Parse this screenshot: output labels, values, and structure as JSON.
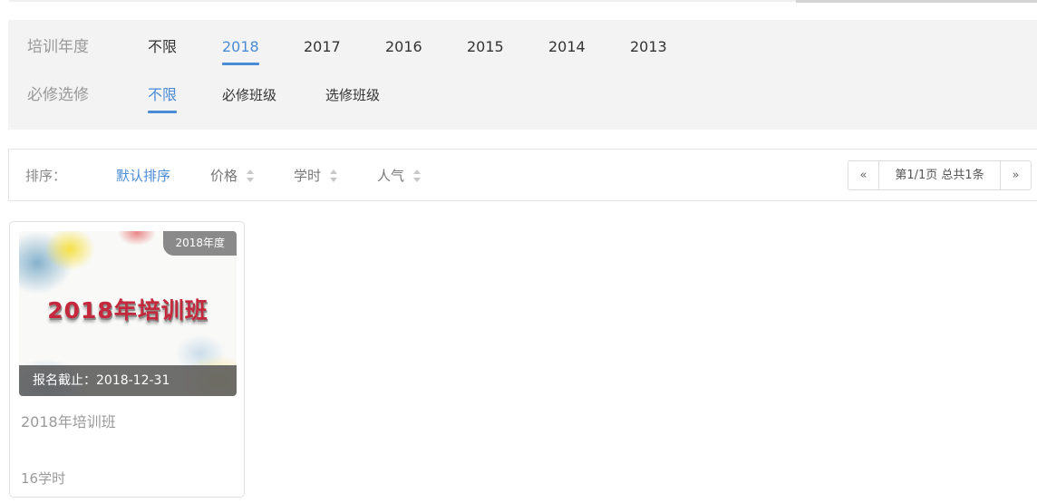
{
  "filters": {
    "year": {
      "label": "培训年度",
      "options": [
        "不限",
        "2018",
        "2017",
        "2016",
        "2015",
        "2014",
        "2013"
      ],
      "selected": "2018"
    },
    "type": {
      "label": "必修选修",
      "options": [
        "不限",
        "必修班级",
        "选修班级"
      ],
      "selected": "不限"
    }
  },
  "sort": {
    "label": "排序：",
    "items": [
      "默认排序",
      "价格",
      "学时",
      "人气"
    ],
    "active": "默认排序"
  },
  "pagination": {
    "prev": "«",
    "info": "第1/1页 总共1条",
    "next": "»"
  },
  "course": {
    "image_title": "2018年培训班",
    "year_badge": "2018年度",
    "deadline": "报名截止：2018-12-31",
    "title": "2018年培训班",
    "hours": "16学时"
  },
  "colors": {
    "accent": "#4a8bd6",
    "panel_bg": "#f3f3f3",
    "muted_text": "#999999"
  }
}
